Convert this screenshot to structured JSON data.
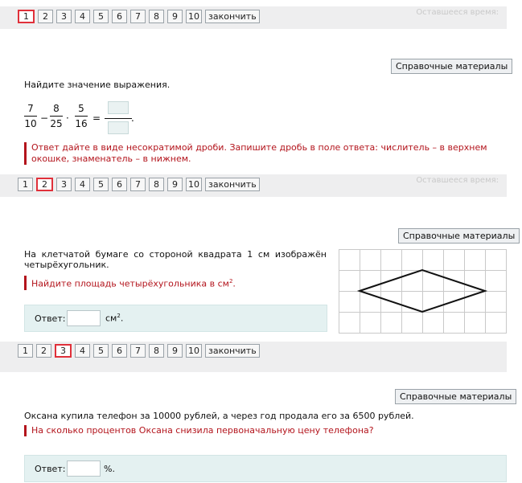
{
  "nav": {
    "pages": [
      "1",
      "2",
      "3",
      "4",
      "5",
      "6",
      "7",
      "8",
      "9",
      "10"
    ],
    "finish_label": "закончить"
  },
  "ghost_timer": "Оставшееся время:",
  "reference_label": "Справочные материалы",
  "task1": {
    "prompt": "Найдите значение выражения.",
    "expr": {
      "f1": {
        "num": "7",
        "den": "10"
      },
      "op1": "−",
      "f2": {
        "num": "8",
        "den": "25"
      },
      "op2": "·",
      "f3": {
        "num": "5",
        "den": "16"
      },
      "eq": "=",
      "tail": "."
    },
    "instruction": "Ответ дайте в виде несократимой дроби. Запишите дробь в поле ответа: числитель – в верхнем окошке, знаменатель – в нижнем."
  },
  "task2": {
    "prompt": "На клетчатой бумаге со стороной квадрата 1 см изображён четырёхугольник.",
    "instruction_prefix": "Найдите площадь четырёхугольника в см",
    "instruction_sup": "2",
    "instruction_suffix": ".",
    "answer_label": "Ответ:",
    "unit_prefix": "см",
    "unit_sup": "2",
    "unit_suffix": "."
  },
  "task3": {
    "prompt": "Оксана купила телефон за 10000 рублей, а через год продала его за 6500 рублей.",
    "instruction": "На сколько процентов Оксана снизила первоначальную цену телефона?",
    "answer_label": "Ответ:",
    "unit": "%."
  },
  "colors": {
    "accent_red": "#b3141c",
    "active_border": "#e0303a",
    "answer_bg": "#e4f1f1",
    "nav_bg": "#eeeeef"
  }
}
